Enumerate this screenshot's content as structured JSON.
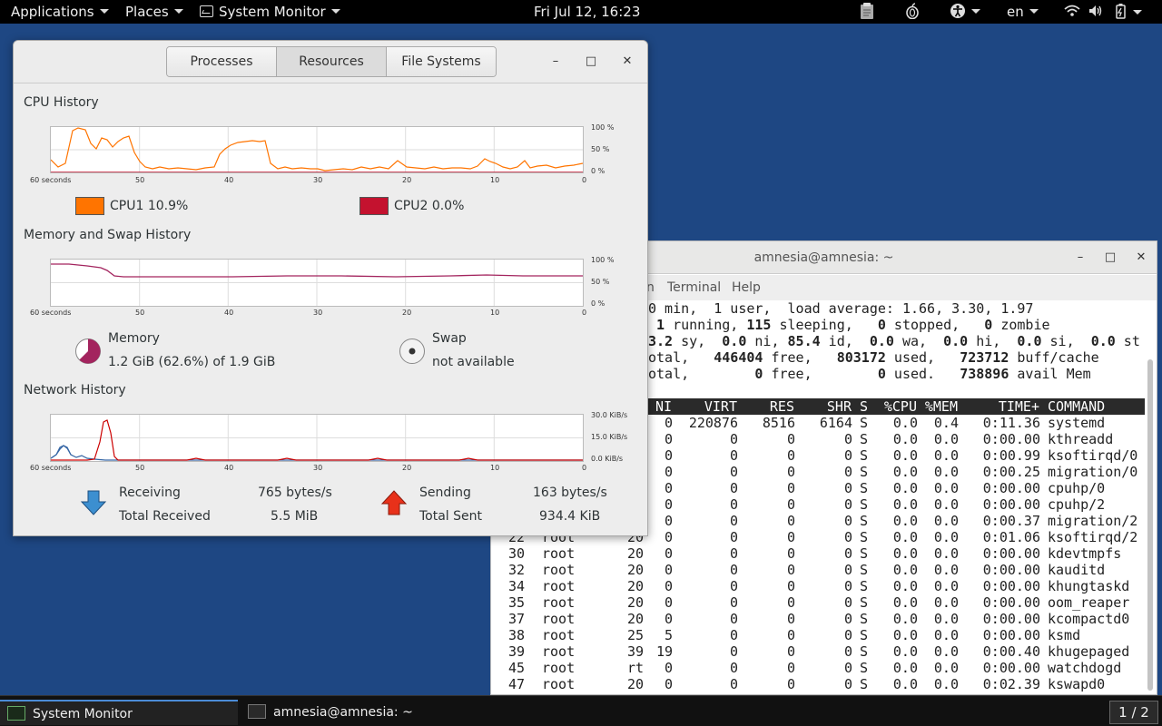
{
  "topbar": {
    "applications": "Applications",
    "places": "Places",
    "app_name": "System Monitor",
    "clock": "Fri Jul 12, 16:23",
    "language": "en"
  },
  "sysmon": {
    "tabs": [
      "Processes",
      "Resources",
      "File Systems"
    ],
    "cpu": {
      "title": "CPU History",
      "cpu1_label": "CPU1 10.9%",
      "cpu2_label": "CPU2 0.0%",
      "cpu1_color": "#ff7400",
      "cpu2_color": "#c4122f",
      "y_ticks": [
        "100 %",
        "50 %",
        "0 %"
      ],
      "x_ticks": [
        "60 seconds",
        "50",
        "40",
        "30",
        "20",
        "10",
        "0"
      ]
    },
    "memory": {
      "title": "Memory and Swap History",
      "memory_label": "Memory",
      "memory_value": "1.2 GiB (62.6%) of 1.9 GiB",
      "memory_fraction": 0.626,
      "swap_label": "Swap",
      "swap_value": "not available",
      "y_ticks": [
        "100 %",
        "50 %",
        "0 %"
      ],
      "x_ticks": [
        "60 seconds",
        "50",
        "40",
        "30",
        "20",
        "10",
        "0"
      ]
    },
    "network": {
      "title": "Network History",
      "receiving_label": "Receiving",
      "receiving_value": "765 bytes/s",
      "total_received_label": "Total Received",
      "total_received_value": "5.5 MiB",
      "sending_label": "Sending",
      "sending_value": "163 bytes/s",
      "total_sent_label": "Total Sent",
      "total_sent_value": "934.4 KiB",
      "y_ticks": [
        "30.0 KiB/s",
        "15.0 KiB/s",
        "0.0 KiB/s"
      ],
      "x_ticks": [
        "60 seconds",
        "50",
        "40",
        "30",
        "20",
        "10",
        "0"
      ]
    }
  },
  "terminal": {
    "title": "amnesia@amnesia: ~",
    "menu": [
      "n",
      "Terminal",
      "Help"
    ],
    "summary": [
      "0 min,  1 user,  load average: 1.66, 3.30, 1.97",
      " 1 running, 115 sleeping,   0 stopped,   0 zombie",
      "3.2 sy,  0.0 ni, 85.4 id,  0.0 wa,  0.0 hi,  0.0 si,  0.0 st",
      "otal,   446404 free,   803172 used,   723712 buff/cache",
      "otal,        0 free,        0 used.   738896 avail Mem"
    ],
    "headers": [
      "NI",
      "VIRT",
      "RES",
      "SHR",
      "S",
      "%CPU",
      "%MEM",
      "TIME+",
      "COMMAND"
    ],
    "rows": [
      [
        "",
        "",
        "",
        "0",
        "220876",
        "8516",
        "6164",
        "S",
        "0.0",
        "0.4",
        "0:11.36",
        "systemd"
      ],
      [
        "",
        "",
        "",
        "0",
        "0",
        "0",
        "0",
        "S",
        "0.0",
        "0.0",
        "0:00.00",
        "kthreadd"
      ],
      [
        "",
        "",
        "",
        "0",
        "0",
        "0",
        "0",
        "S",
        "0.0",
        "0.0",
        "0:00.99",
        "ksoftirqd/0"
      ],
      [
        "",
        "",
        "",
        "0",
        "0",
        "0",
        "0",
        "S",
        "0.0",
        "0.0",
        "0:00.25",
        "migration/0"
      ],
      [
        "",
        "",
        "",
        "0",
        "0",
        "0",
        "0",
        "S",
        "0.0",
        "0.0",
        "0:00.00",
        "cpuhp/0"
      ],
      [
        "",
        "",
        "",
        "0",
        "0",
        "0",
        "0",
        "S",
        "0.0",
        "0.0",
        "0:00.00",
        "cpuhp/2"
      ],
      [
        "",
        "",
        "",
        "0",
        "0",
        "0",
        "0",
        "S",
        "0.0",
        "0.0",
        "0:00.37",
        "migration/2"
      ],
      [
        "22",
        "root",
        "20",
        "0",
        "0",
        "0",
        "0",
        "S",
        "0.0",
        "0.0",
        "0:01.06",
        "ksoftirqd/2"
      ],
      [
        "30",
        "root",
        "20",
        "0",
        "0",
        "0",
        "0",
        "S",
        "0.0",
        "0.0",
        "0:00.00",
        "kdevtmpfs"
      ],
      [
        "32",
        "root",
        "20",
        "0",
        "0",
        "0",
        "0",
        "S",
        "0.0",
        "0.0",
        "0:00.00",
        "kauditd"
      ],
      [
        "34",
        "root",
        "20",
        "0",
        "0",
        "0",
        "0",
        "S",
        "0.0",
        "0.0",
        "0:00.00",
        "khungtaskd"
      ],
      [
        "35",
        "root",
        "20",
        "0",
        "0",
        "0",
        "0",
        "S",
        "0.0",
        "0.0",
        "0:00.00",
        "oom_reaper"
      ],
      [
        "37",
        "root",
        "20",
        "0",
        "0",
        "0",
        "0",
        "S",
        "0.0",
        "0.0",
        "0:00.00",
        "kcompactd0"
      ],
      [
        "38",
        "root",
        "25",
        "5",
        "0",
        "0",
        "0",
        "S",
        "0.0",
        "0.0",
        "0:00.00",
        "ksmd"
      ],
      [
        "39",
        "root",
        "39",
        "19",
        "0",
        "0",
        "0",
        "S",
        "0.0",
        "0.0",
        "0:00.40",
        "khugepaged"
      ],
      [
        "45",
        "root",
        "rt",
        "0",
        "0",
        "0",
        "0",
        "S",
        "0.0",
        "0.0",
        "0:00.00",
        "watchdogd"
      ],
      [
        "47",
        "root",
        "20",
        "0",
        "0",
        "0",
        "0",
        "S",
        "0.0",
        "0.0",
        "0:02.39",
        "kswapd0"
      ]
    ]
  },
  "taskbar": {
    "task1": "System Monitor",
    "task2": "amnesia@amnesia: ~",
    "workspace": "1 / 2"
  }
}
